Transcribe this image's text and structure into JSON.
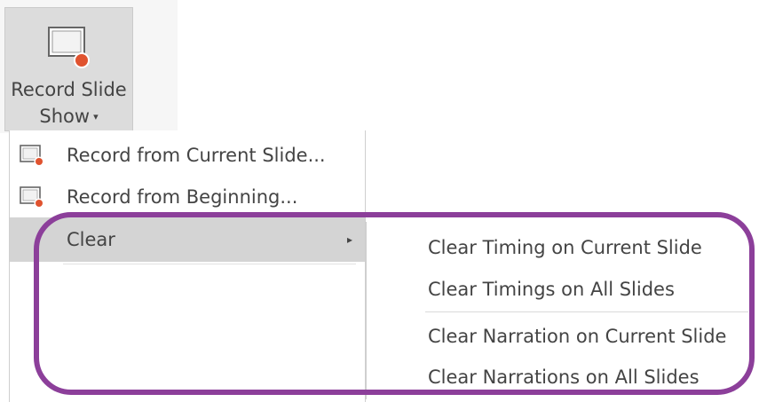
{
  "ribbon": {
    "button_line1": "Record Slide",
    "button_line2": "Show",
    "caret": "▾",
    "icon": "record-slideshow-icon"
  },
  "menu": {
    "items": [
      {
        "label": "Record from Current Slide...",
        "icon": "record-slide-icon"
      },
      {
        "label": "Record from Beginning...",
        "icon": "record-slide-icon"
      },
      {
        "label": "Clear",
        "submenu_arrow": "▸"
      }
    ]
  },
  "submenu": {
    "items": [
      {
        "label": "Clear Timing on Current Slide"
      },
      {
        "label": "Clear Timings on All Slides"
      },
      {
        "label": "Clear Narration on Current Slide"
      },
      {
        "label": "Clear Narrations on All Slides"
      }
    ]
  },
  "colors": {
    "highlight_ring": "#8c3f9a",
    "record_dot": "#e0532f",
    "hover_background": "#d4d4d4"
  }
}
